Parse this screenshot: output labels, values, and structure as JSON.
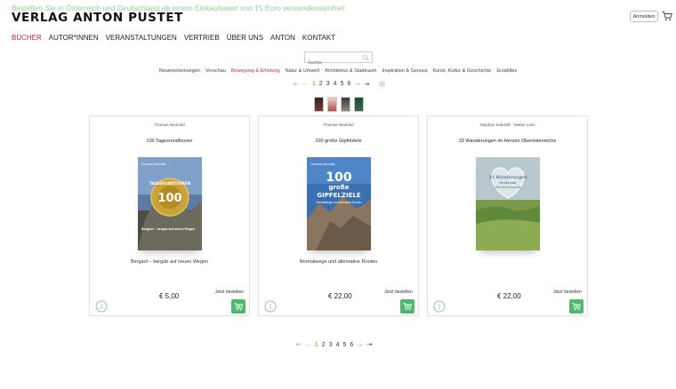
{
  "header": {
    "promo_text": "Bestellen Sie in Österreich und Deutschland ab einem Einkaufswert von 15 Euro versandkostenfrei!",
    "logo_text": "VERLAG ANTON PUSTET",
    "login_label": "Anmelden",
    "cart_icon": "shopping-cart-icon"
  },
  "main_nav": {
    "items": [
      "BÜCHER",
      "AUTOR*INNEN",
      "VERANSTALTUNGEN",
      "VERTRIEB",
      "ÜBER UNS",
      "ANTON",
      "KONTAKT"
    ],
    "active_index": 0
  },
  "search": {
    "placeholder": "Suche",
    "icon": "search-icon"
  },
  "categories": {
    "items": [
      "Neuerscheinungen",
      "Vorschau",
      "Bewegung & Erholung",
      "Natur & Umwelt",
      "Architektur & Stadtraum",
      "Inspiration & Genuss",
      "Kunst, Kultur & Geschichte",
      "Erzähltes"
    ],
    "active_index": 2
  },
  "pagination": {
    "pages": [
      "1",
      "2",
      "3",
      "4",
      "5",
      "6"
    ],
    "current": "1",
    "first_icon": "first-page-icon",
    "prev_icon": "prev-page-icon",
    "next_icon": "next-page-icon",
    "last_icon": "last-page-icon",
    "settings_icon": "gear-icon"
  },
  "colors": {
    "accent": "#c8254a",
    "promo": "#8fcf9e",
    "cart_button": "#4cb96f",
    "current_page": "#e5a03a"
  },
  "products": [
    {
      "author": "Thomas Neuhold",
      "title": "100 Tagesrundtouren",
      "subtitle": "Bergauf – bergab auf neuen Wegen",
      "price": "€ 5,00",
      "order_label": "Jetzt bestellen",
      "cover": {
        "author": "Thomas Neuhold",
        "badge": "100",
        "badge_text": "TAGESRUNDTOUREN",
        "overlay": "Bergauf – bergab auf neuen Wegen"
      }
    },
    {
      "author": "Thomas Neuhold",
      "title": "100 große Gipfelziele",
      "subtitle": "Normalwege und alternative Routen",
      "price": "€ 22,00",
      "order_label": "Jetzt bestellen",
      "cover": {
        "author": "Thomas Neuhold",
        "big": "100",
        "line2": "große",
        "line3": "GIPFELZIELE",
        "overlay": "Normalwege und alternative Routen"
      }
    },
    {
      "author": "Stephan Sokoloff · Walter Lanz",
      "title": "33 Wanderungen im Herzen Oberösterreichs",
      "subtitle": "",
      "price": "€ 22,00",
      "order_label": "Jetzt bestellen",
      "cover": {
        "heading": "33 Wanderungen",
        "sub": "im Herzen",
        "sub2": "Oberösterreichs"
      }
    }
  ]
}
